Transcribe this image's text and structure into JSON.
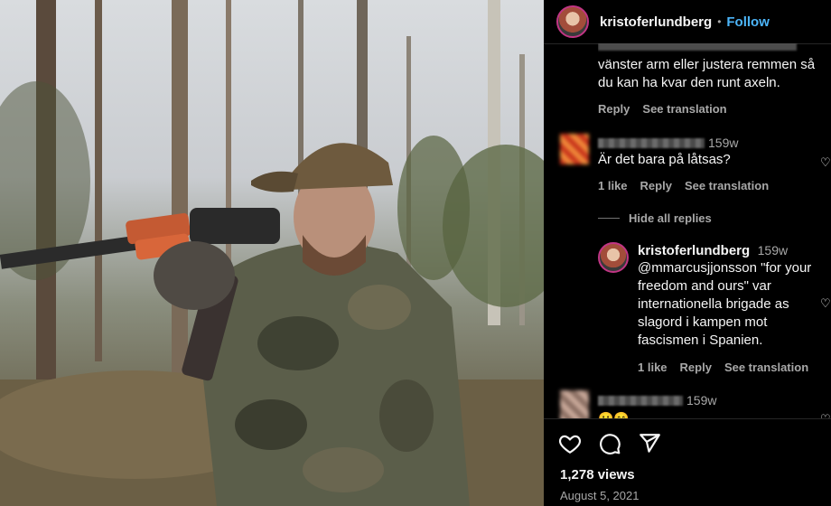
{
  "post": {
    "username": "kristoferlundberg",
    "separator": "•",
    "follow_label": "Follow",
    "views": "1,278 views",
    "date": "August 5, 2021"
  },
  "comments": [
    {
      "text": "vänster arm eller justera remmen så du kan ha kvar den runt axeln.",
      "actions": {
        "reply": "Reply",
        "translate": "See translation"
      }
    },
    {
      "time": "159w",
      "text": "Är det bara på låtsas?",
      "actions": {
        "likes": "1 like",
        "reply": "Reply",
        "translate": "See translation"
      }
    },
    {
      "hide_replies": "Hide all replies",
      "reply": {
        "username": "kristoferlundberg",
        "time": "159w",
        "text": "@mmarcusjjonsson \"for your freedom and ours\" var internationella brigade as slagord i kampen mot fascismen i Spanien.",
        "actions": {
          "likes": "1 like",
          "reply": "Reply",
          "translate": "See translation"
        }
      }
    },
    {
      "time": "159w",
      "text": "😀😄"
    }
  ],
  "icons": [
    "heart-icon",
    "comment-icon",
    "share-icon",
    "like-comment-icon"
  ],
  "colors": {
    "follow": "#4cb5f9",
    "background": "#000000",
    "muted": "#a8a8a8"
  }
}
